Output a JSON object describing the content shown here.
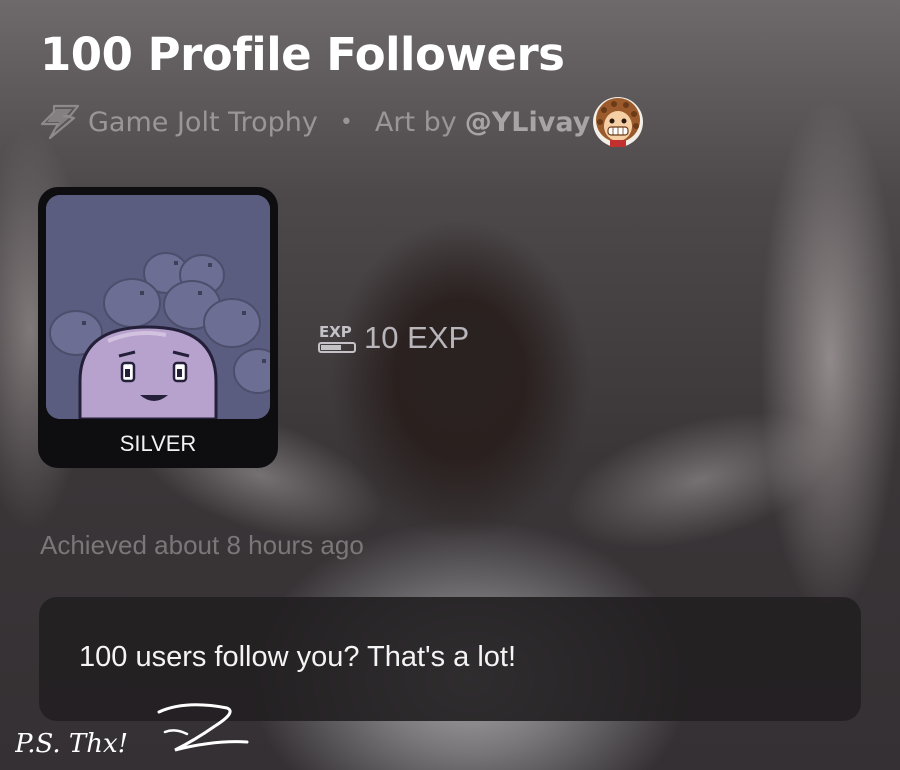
{
  "trophy": {
    "title": "100 Profile Followers",
    "source": "Game Jolt Trophy",
    "separator": "•",
    "art_by_prefix": "Art by",
    "artist": "@YLivay",
    "tier": "SILVER",
    "exp": "10 EXP",
    "exp_icon_label": "EXP",
    "achieved": "Achieved about 8 hours ago",
    "description": "100 users follow you? That's a lot!",
    "postscript": "P.S. Thx!"
  },
  "icons": {
    "source_icon": "lightning-bolt-icon",
    "exp_icon": "exp-icon",
    "avatar": "artist-avatar"
  },
  "colors": {
    "title": "#ffffff",
    "muted": "#9a9698",
    "card": "#0e0d10",
    "panel": "#221f21"
  }
}
